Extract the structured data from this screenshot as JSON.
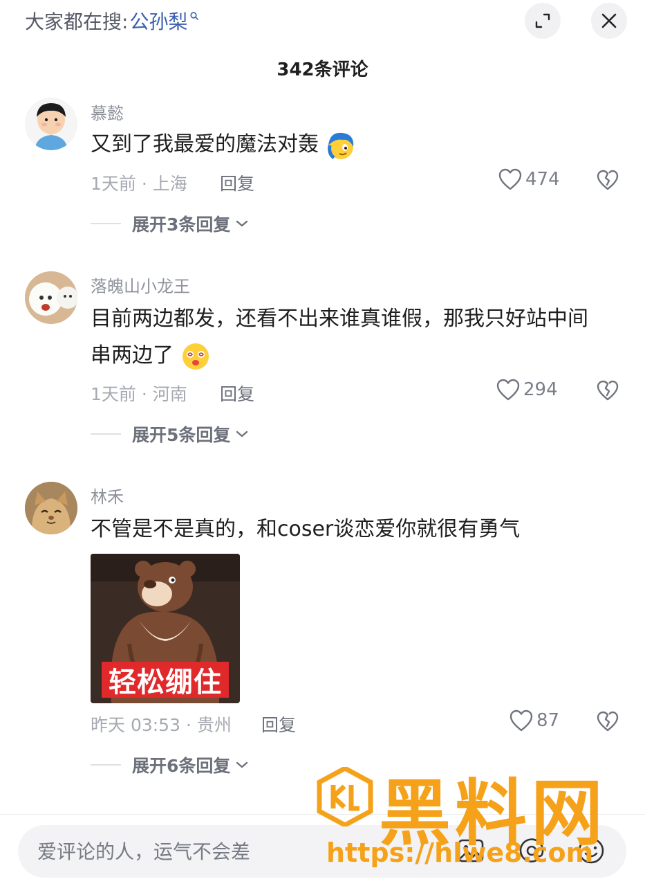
{
  "header": {
    "search_label": "大家都在搜:",
    "search_term": "公孙梨",
    "comment_count": "342条评论"
  },
  "icons": {
    "search": "magnifier-icon",
    "expand": "expand-icon",
    "close": "close-icon",
    "like": "heart-outline-icon",
    "dislike": "broken-heart-icon",
    "image": "image-icon",
    "mention": "at-icon",
    "emoji": "smiley-icon"
  },
  "comments": [
    {
      "username": "慕懿",
      "text": "又到了我最爱的魔法对轰",
      "time": "1天前",
      "location": "上海",
      "reply_label": "回复",
      "likes": "474",
      "expand_label": "展开3条回复"
    },
    {
      "username": "落魄山小龙王",
      "text_line1": "目前两边都发，还看不出来谁真谁假，那我只好站中间",
      "text_line2": "串两边了",
      "time": "1天前",
      "location": "河南",
      "reply_label": "回复",
      "likes": "294",
      "expand_label": "展开5条回复"
    },
    {
      "username": "林禾",
      "text": "不管是不是真的，和coser谈恋爱你就很有勇气",
      "sticker_caption": "轻松绷住",
      "time": "昨天 03:53",
      "location": "贵州",
      "reply_label": "回复",
      "likes": "87",
      "expand_label": "展开6条回复"
    }
  ],
  "composer": {
    "placeholder": "爱评论的人，运气不会差"
  },
  "watermark": {
    "title": "黑料网",
    "url": "https://hlwe8.com"
  },
  "colors": {
    "accent_link": "#3b5fb0",
    "watermark": "#f5a21a",
    "sticker_caption_bg": "#e0292b"
  }
}
